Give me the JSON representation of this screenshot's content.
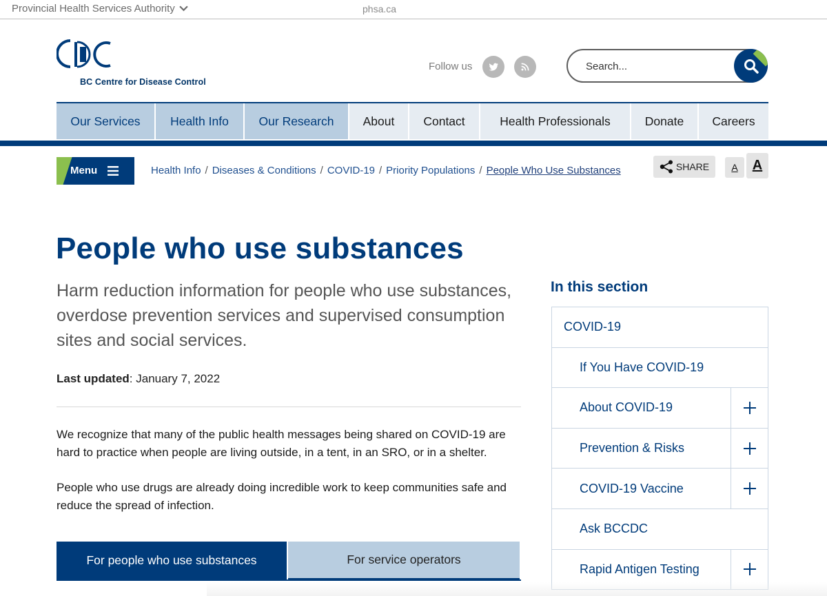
{
  "topbar": {
    "org": "Provincial Health Services Authority",
    "domain": "phsa.ca"
  },
  "logo": {
    "subtitle": "BC Centre for Disease Control"
  },
  "header": {
    "follow_label": "Follow us",
    "search_placeholder": "Search..."
  },
  "nav": [
    {
      "label": "Our Services"
    },
    {
      "label": "Health Info"
    },
    {
      "label": "Our Research"
    },
    {
      "label": "About"
    },
    {
      "label": "Contact"
    },
    {
      "label": "Health Professionals"
    },
    {
      "label": "Donate"
    },
    {
      "label": "Careers"
    }
  ],
  "menu_label": "Menu",
  "breadcrumb": [
    "Health Info",
    "Diseases & Conditions",
    "COVID-19",
    "Priority Populations",
    "People Who Use Substances"
  ],
  "tools": {
    "share": "SHARE",
    "font_small": "A",
    "font_large": "A"
  },
  "page": {
    "title": "People who use substances",
    "intro": "Harm reduction information for people who use substances, overdose prevention services and supervised consumption sites and social services.",
    "updated_label": "Last updated",
    "updated_value": ": January 7, 2022",
    "para1": "We recognize that many of the public health messages being shared on COVID-19 are hard to practice when people are living outside, in a tent, in an SRO, or in a shelter.",
    "para2": "People who use drugs are already doing incredible work to keep communities safe and reduce the spread of infection."
  },
  "tabs": [
    "For people who use substances",
    "For service operators"
  ],
  "sidebar": {
    "title": "In this section",
    "items": [
      {
        "label": "COVID-19"
      },
      {
        "label": "If You Have COVID-19"
      },
      {
        "label": "About COVID-19"
      },
      {
        "label": "Prevention & Risks"
      },
      {
        "label": "COVID-19 Vaccine"
      },
      {
        "label": "Ask BCCDC"
      },
      {
        "label": "Rapid Antigen Testing"
      }
    ]
  },
  "colors": {
    "brand_blue": "#003b7a",
    "accent_green": "#8bbf4e",
    "nav_light": "#b8cde0"
  }
}
